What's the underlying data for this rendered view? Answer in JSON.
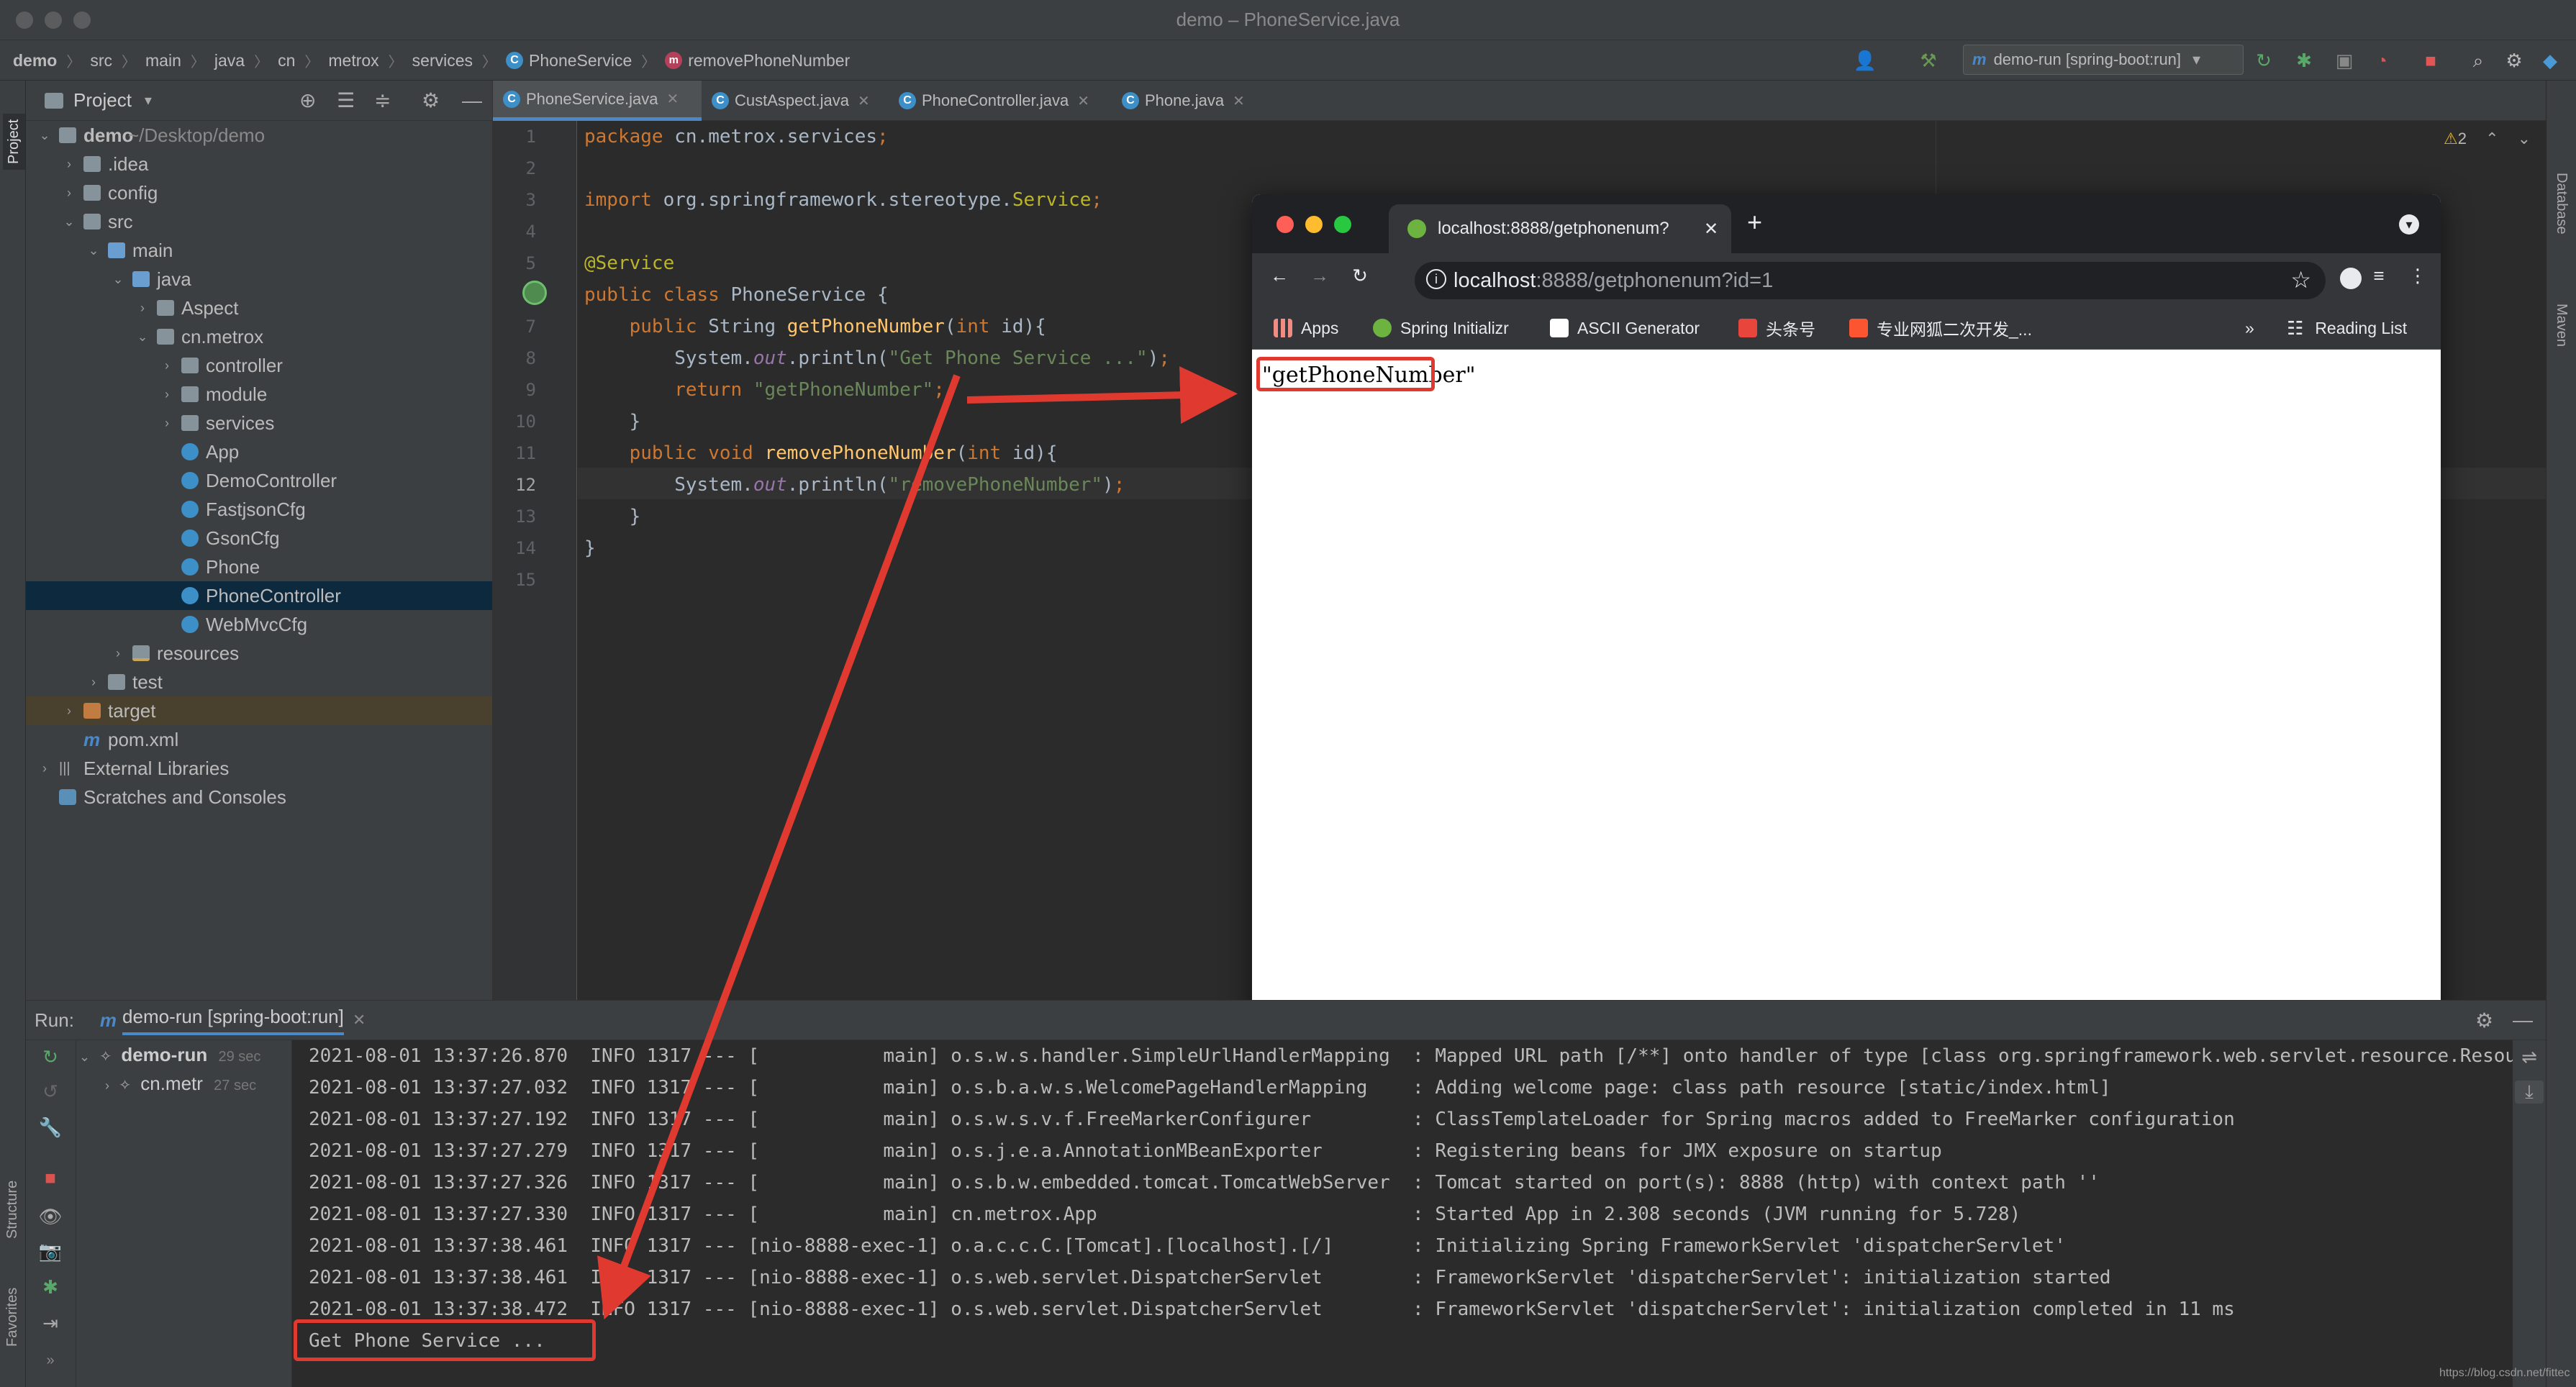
{
  "window": {
    "title": "demo – PhoneService.java"
  },
  "breadcrumbs": [
    "demo",
    "src",
    "main",
    "java",
    "cn",
    "metrox",
    "services",
    "PhoneService",
    "removePhoneNumber"
  ],
  "toolbar": {
    "run_config": "demo-run [spring-boot:run]"
  },
  "side": {
    "project": "Project",
    "structure": "Structure",
    "favorites": "Favorites",
    "database": "Database",
    "maven": "Maven"
  },
  "project_panel": {
    "title": "Project",
    "tree": [
      {
        "label": "demo",
        "extra": "~/Desktop/demo",
        "arrow": "⌄"
      },
      {
        "label": ".idea",
        "arrow": "›"
      },
      {
        "label": "config",
        "arrow": "›"
      },
      {
        "label": "src",
        "arrow": "⌄"
      },
      {
        "label": "main",
        "arrow": "⌄"
      },
      {
        "label": "java",
        "arrow": "⌄"
      },
      {
        "label": "Aspect",
        "arrow": "›"
      },
      {
        "label": "cn.metrox",
        "arrow": "⌄"
      },
      {
        "label": "controller",
        "arrow": "›"
      },
      {
        "label": "module",
        "arrow": "›"
      },
      {
        "label": "services",
        "arrow": "›"
      },
      {
        "label": "App"
      },
      {
        "label": "DemoController"
      },
      {
        "label": "FastjsonCfg"
      },
      {
        "label": "GsonCfg"
      },
      {
        "label": "Phone"
      },
      {
        "label": "PhoneController"
      },
      {
        "label": "WebMvcCfg"
      },
      {
        "label": "resources",
        "arrow": "›"
      },
      {
        "label": "test",
        "arrow": "›"
      },
      {
        "label": "target",
        "arrow": "›"
      },
      {
        "label": "pom.xml"
      },
      {
        "label": "External Libraries",
        "arrow": "›"
      },
      {
        "label": "Scratches and Consoles"
      }
    ]
  },
  "editor": {
    "tabs": [
      "PhoneService.java",
      "CustAspect.java",
      "PhoneController.java",
      "Phone.java"
    ],
    "warnings": "2",
    "line_numbers": [
      "1",
      "2",
      "3",
      "4",
      "5",
      "6",
      "7",
      "8",
      "9",
      "10",
      "11",
      "12",
      "13",
      "14",
      "15"
    ],
    "lines": [
      {
        "parts": [
          [
            "kw",
            "package "
          ],
          [
            "",
            "cn.metrox.services"
          ],
          [
            "kw",
            ";"
          ]
        ]
      },
      {
        "parts": []
      },
      {
        "parts": [
          [
            "kw",
            "import "
          ],
          [
            "",
            "org.springframework.stereotype."
          ],
          [
            "ann",
            "Service"
          ],
          [
            "kw",
            ";"
          ]
        ]
      },
      {
        "parts": []
      },
      {
        "parts": [
          [
            "ann",
            "@Service"
          ]
        ]
      },
      {
        "parts": [
          [
            "kw",
            "public class "
          ],
          [
            "",
            "PhoneService {"
          ]
        ]
      },
      {
        "parts": [
          [
            "",
            "    "
          ],
          [
            "kw",
            "public "
          ],
          [
            "",
            "String "
          ],
          [
            "fn",
            "getPhoneNumber"
          ],
          [
            "",
            "("
          ],
          [
            "kw",
            "int "
          ],
          [
            "",
            "id){"
          ]
        ]
      },
      {
        "parts": [
          [
            "",
            "        System."
          ],
          [
            "it",
            "out"
          ],
          [
            "",
            ".println("
          ],
          [
            "str",
            "\"Get Phone Service ...\""
          ],
          [
            "",
            ")"
          ],
          [
            "kw",
            ";"
          ]
        ]
      },
      {
        "parts": [
          [
            "",
            "        "
          ],
          [
            "kw",
            "return "
          ],
          [
            "str",
            "\"getPhoneNumber\""
          ],
          [
            "kw",
            ";"
          ]
        ]
      },
      {
        "parts": [
          [
            "",
            "    }"
          ]
        ]
      },
      {
        "parts": [
          [
            "",
            "    "
          ],
          [
            "kw",
            "public void "
          ],
          [
            "fn",
            "removePhoneNumber"
          ],
          [
            "",
            "("
          ],
          [
            "kw",
            "int "
          ],
          [
            "",
            "id){"
          ]
        ]
      },
      {
        "parts": [
          [
            "",
            "        System."
          ],
          [
            "it",
            "out"
          ],
          [
            "",
            ".println("
          ],
          [
            "str",
            "\"removePhoneNumber\""
          ],
          [
            "",
            ")"
          ],
          [
            "kw",
            ";"
          ]
        ]
      },
      {
        "parts": [
          [
            "",
            "    }"
          ]
        ]
      },
      {
        "parts": [
          [
            "",
            "}"
          ]
        ]
      },
      {
        "parts": []
      }
    ]
  },
  "browser": {
    "tab_title": "localhost:8888/getphonenum?",
    "url_host": "localhost",
    "url_rest": ":8888/getphonenum?id=1",
    "bookmarks": [
      "Apps",
      "Spring Initializr",
      "ASCII Generator",
      "头条号",
      "专业网狐二次开发_..."
    ],
    "more": "»",
    "reading_list": "Reading List",
    "response": "\"getPhoneNumber\""
  },
  "run": {
    "label": "Run:",
    "config": "demo-run [spring-boot:run]",
    "tree": [
      {
        "label": "demo-run",
        "time": "29 sec"
      },
      {
        "label": "cn.metr",
        "time": "27 sec"
      }
    ],
    "log": [
      "2021-08-01 13:37:26.870  INFO 1317 --- [           main] o.s.w.s.handler.SimpleUrlHandlerMapping  : Mapped URL path [/**] onto handler of type [class org.springframework.web.servlet.resource.Resou",
      "2021-08-01 13:37:27.032  INFO 1317 --- [           main] o.s.b.a.w.s.WelcomePageHandlerMapping    : Adding welcome page: class path resource [static/index.html]",
      "2021-08-01 13:37:27.192  INFO 1317 --- [           main] o.s.w.s.v.f.FreeMarkerConfigurer         : ClassTemplateLoader for Spring macros added to FreeMarker configuration",
      "2021-08-01 13:37:27.279  INFO 1317 --- [           main] o.s.j.e.a.AnnotationMBeanExporter        : Registering beans for JMX exposure on startup",
      "2021-08-01 13:37:27.326  INFO 1317 --- [           main] o.s.b.w.embedded.tomcat.TomcatWebServer  : Tomcat started on port(s): 8888 (http) with context path ''",
      "2021-08-01 13:37:27.330  INFO 1317 --- [           main] cn.metrox.App                            : Started App in 2.308 seconds (JVM running for 5.728)",
      "2021-08-01 13:37:38.461  INFO 1317 --- [nio-8888-exec-1] o.a.c.c.C.[Tomcat].[localhost].[/]       : Initializing Spring FrameworkServlet 'dispatcherServlet'",
      "2021-08-01 13:37:38.461  INFO 1317 --- [nio-8888-exec-1] o.s.web.servlet.DispatcherServlet        : FrameworkServlet 'dispatcherServlet': initialization started",
      "2021-08-01 13:37:38.472  INFO 1317 --- [nio-8888-exec-1] o.s.web.servlet.DispatcherServlet        : FrameworkServlet 'dispatcherServlet': initialization completed in 11 ms",
      "Get Phone Service ..."
    ]
  },
  "watermark": "https://blog.csdn.net/fittec",
  "colors": {
    "annotation_red": "#e03a30",
    "accent_blue": "#4a88c7",
    "selection": "#0d293e"
  }
}
